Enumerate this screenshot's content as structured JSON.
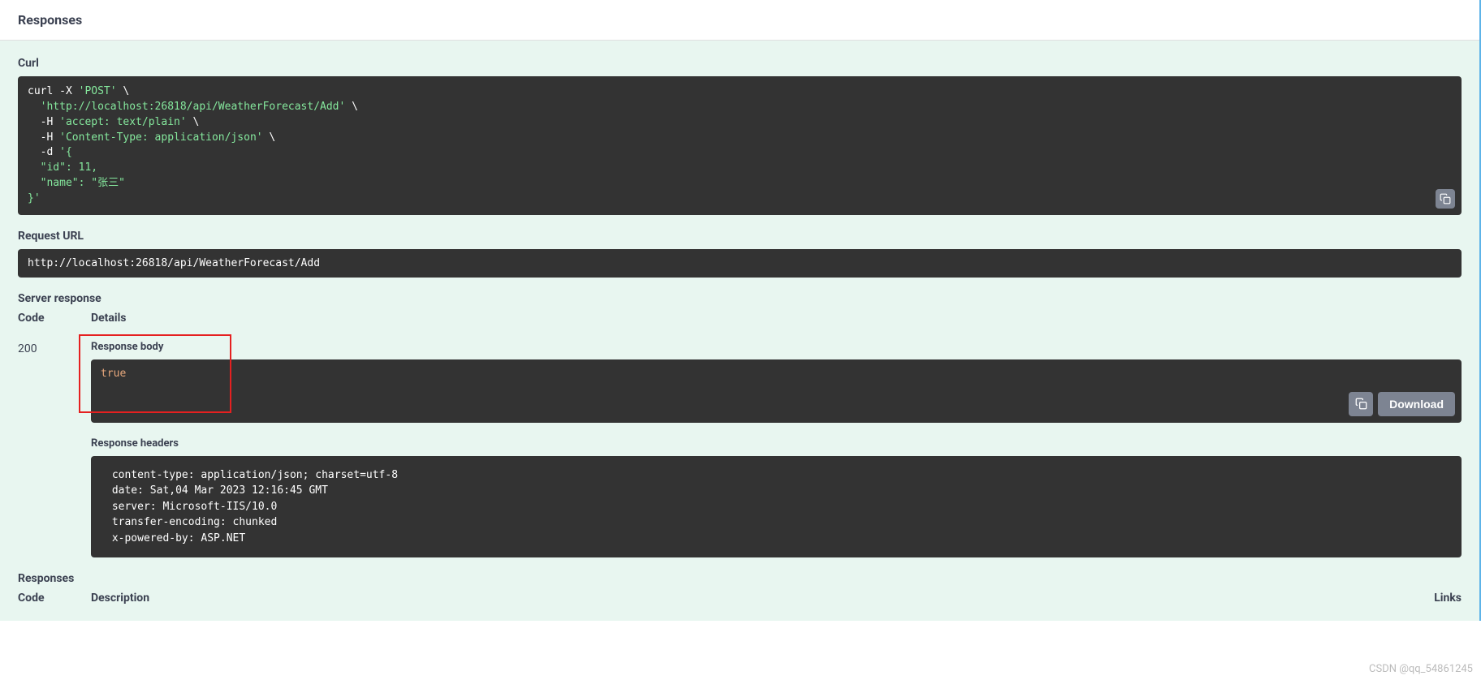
{
  "header": {
    "title": "Responses"
  },
  "curl": {
    "label": "Curl",
    "command": "curl -X 'POST' \\\n  'http://localhost:26818/api/WeatherForecast/Add' \\\n  -H 'accept: text/plain' \\\n  -H 'Content-Type: application/json' \\\n  -d '{\n  \"id\": 11,\n  \"name\": \"张三\"\n}'"
  },
  "request_url": {
    "label": "Request URL",
    "value": "http://localhost:26818/api/WeatherForecast/Add"
  },
  "server_response": {
    "label": "Server response",
    "code_header": "Code",
    "details_header": "Details",
    "status_code": "200",
    "body_label": "Response body",
    "body_value": "true",
    "download_label": "Download",
    "headers_label": "Response headers",
    "headers_value": " content-type: application/json; charset=utf-8 \n date: Sat,04 Mar 2023 12:16:45 GMT \n server: Microsoft-IIS/10.0 \n transfer-encoding: chunked \n x-powered-by: ASP.NET "
  },
  "responses_section": {
    "label": "Responses",
    "code_header": "Code",
    "description_header": "Description",
    "links_header": "Links"
  },
  "watermark": "CSDN @qq_54861245"
}
